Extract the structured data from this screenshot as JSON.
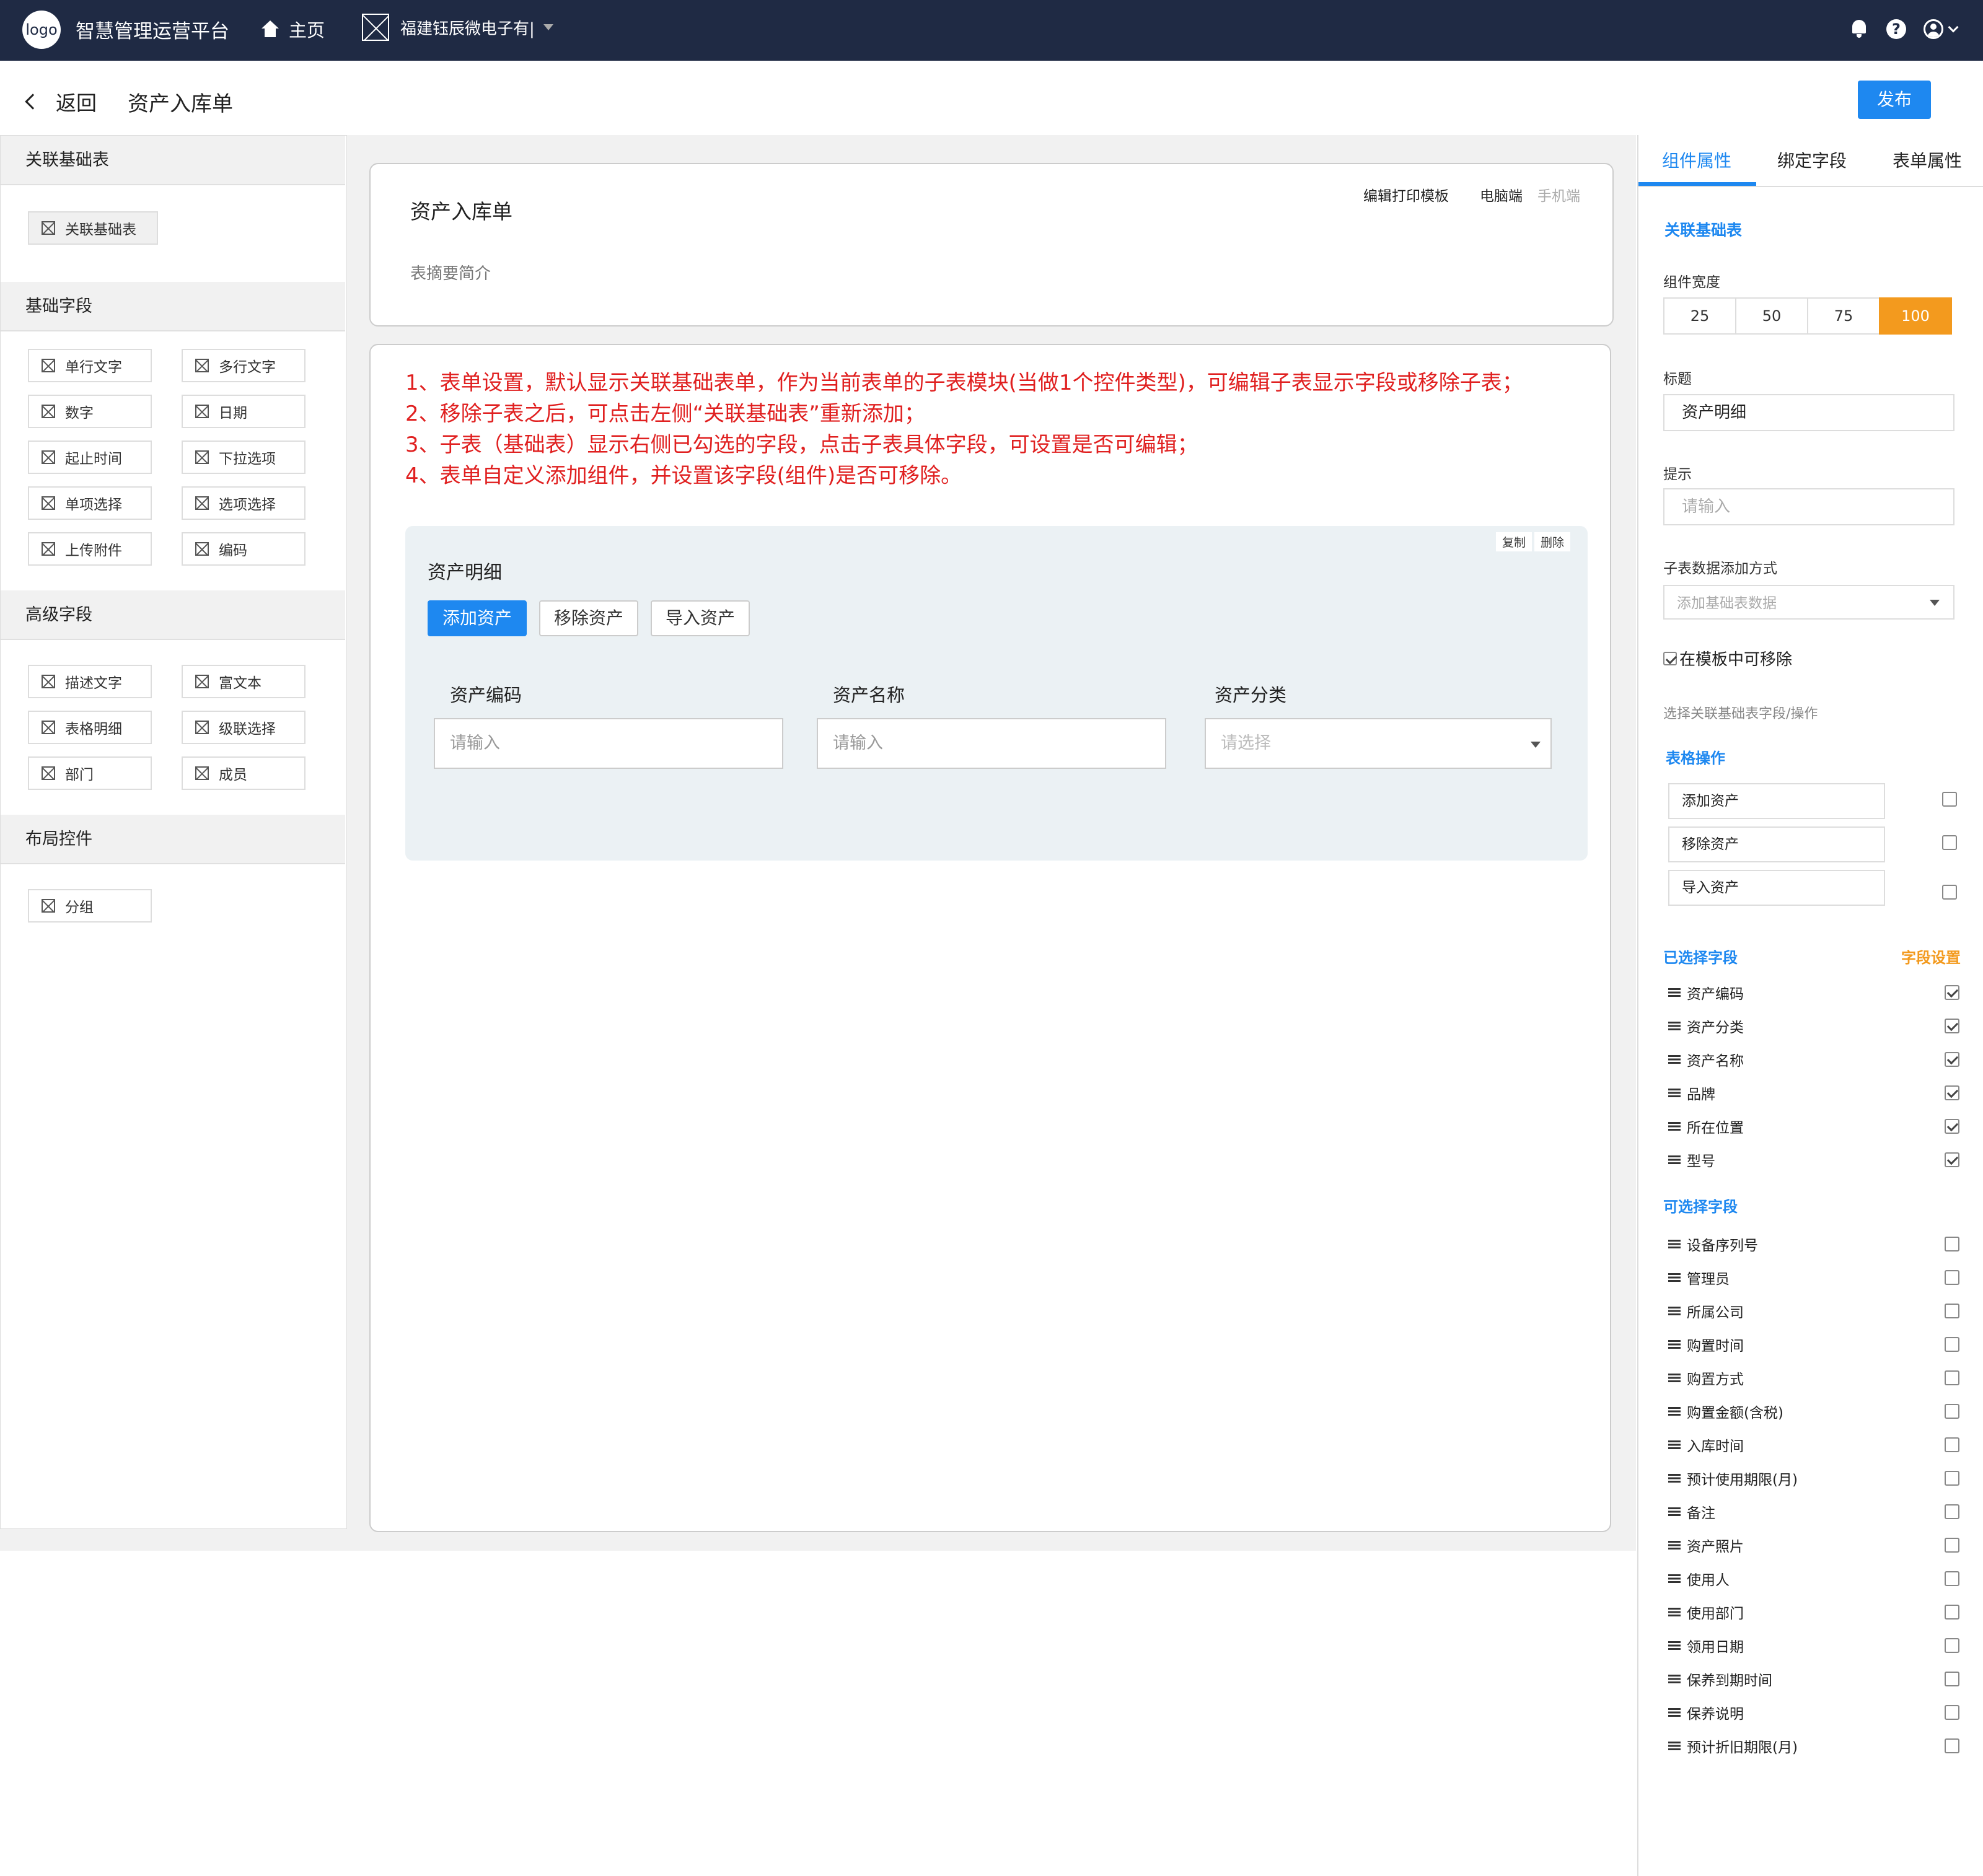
{
  "topbar": {
    "logo": "logo",
    "app_title": "智慧管理运营平台",
    "home": "主页",
    "company": "福建钰辰微电子有|",
    "help": "?"
  },
  "subheader": {
    "back": "返回",
    "title": "资产入库单",
    "publish": "发布"
  },
  "left": {
    "sections": [
      {
        "title": "关联基础表",
        "items": [
          "关联基础表"
        ]
      },
      {
        "title": "基础字段",
        "items": [
          "单行文字",
          "多行文字",
          "数字",
          "日期",
          "起止时间",
          "下拉选项",
          "单项选择",
          "选项选择",
          "上传附件",
          "编码"
        ]
      },
      {
        "title": "高级字段",
        "items": [
          "描述文字",
          "富文本",
          "表格明细",
          "级联选择",
          "部门",
          "成员"
        ]
      },
      {
        "title": "布局控件",
        "items": [
          "分组"
        ]
      }
    ]
  },
  "center": {
    "form_title": "资产入库单",
    "form_desc": "表摘要简介",
    "links": [
      "编辑打印模板",
      "电脑端",
      "手机端"
    ],
    "notes": [
      "1、表单设置，默认显示关联基础表单，作为当前表单的子表模块(当做1个控件类型)，可编辑子表显示字段或移除子表；",
      "2、移除子表之后，可点击左侧“关联基础表”重新添加；",
      "3、子表（基础表）显示右侧已勾选的字段，点击子表具体字段，可设置是否可编辑；",
      "4、表单自定义添加组件，并设置该字段(组件)是否可移除。"
    ],
    "sub": {
      "copy": "复制",
      "delete": "删除",
      "title": "资产明细",
      "buttons": [
        "添加资产",
        "移除资产",
        "导入资产"
      ],
      "columns": [
        {
          "label": "资产编码",
          "placeholder": "请输入"
        },
        {
          "label": "资产名称",
          "placeholder": "请输入"
        },
        {
          "label": "资产分类",
          "placeholder": "请选择"
        }
      ]
    }
  },
  "right": {
    "tabs": [
      "组件属性",
      "绑定字段",
      "表单属性"
    ],
    "section_title": "关联基础表",
    "width_label": "组件宽度",
    "widths": [
      "25",
      "50",
      "75",
      "100"
    ],
    "width_selected": "100",
    "title_label": "标题",
    "title_value": "资产明细",
    "tip_label": "提示",
    "tip_placeholder": "请输入",
    "addmode_label": "子表数据添加方式",
    "addmode_value": "添加基础表数据",
    "removable": "在模板中可移除",
    "choose_label": "选择关联基础表字段/操作",
    "ops_title": "表格操作",
    "ops": [
      "添加资产",
      "移除资产",
      "导入资产"
    ],
    "selected_title": "已选择字段",
    "field_settings": "字段设置",
    "selected": [
      "资产编码",
      "资产分类",
      "资产名称",
      "品牌",
      "所在位置",
      "型号"
    ],
    "available_title": "可选择字段",
    "available": [
      "设备序列号",
      "管理员",
      "所属公司",
      "购置时间",
      "购置方式",
      "购置金额(含税)",
      "入库时间",
      "预计使用期限(月)",
      "备注",
      "资产照片",
      "使用人",
      "使用部门",
      "领用日期",
      "保养到期时间",
      "保养说明",
      "预计折旧期限(月)"
    ]
  }
}
